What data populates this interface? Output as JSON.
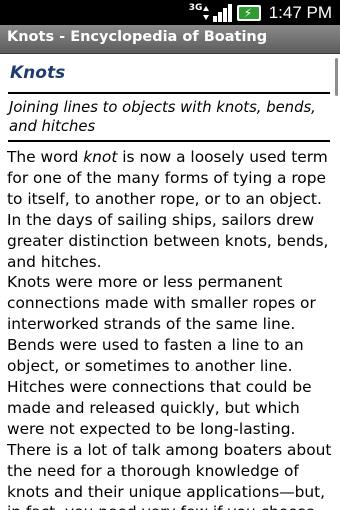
{
  "status_bar": {
    "network_label": "3G",
    "time": "1:47 PM",
    "icons": [
      "network-3g-icon",
      "signal-strength-icon",
      "battery-charging-icon"
    ],
    "battery_color": "#2e9c2e"
  },
  "title_bar": {
    "title": "Knots - Encyclopedia of Boating"
  },
  "article": {
    "heading": "Knots",
    "subtitle": "Joining lines to objects with knots, bends, and hitches",
    "paragraphs": [
      {
        "lead": "The word ",
        "emphasis": "knot",
        "text": " is now a loosely used term for one of the many forms of tying a rope to itself, to another rope, or to an object. In the days of sailing ships, sailors drew greater distinction between knots, bends, and hitches."
      },
      {
        "text": " Knots were more or less permanent connections made with smaller ropes or interworked strands of the same line. Bends were used to fasten a line to an object, or sometimes to another line. Hitches were connections that could be made and released quickly, but which were not expected to be long-lasting."
      },
      {
        "text": " There is a lot of talk among boaters about the need for a thorough knowledge of knots and their unique applications—but, in fact, you need very few if you choose"
      }
    ]
  },
  "colors": {
    "status_bar_bg": "#000000",
    "title_bar_bg": "#6e6e6e",
    "heading_color": "#1e3d6e"
  }
}
